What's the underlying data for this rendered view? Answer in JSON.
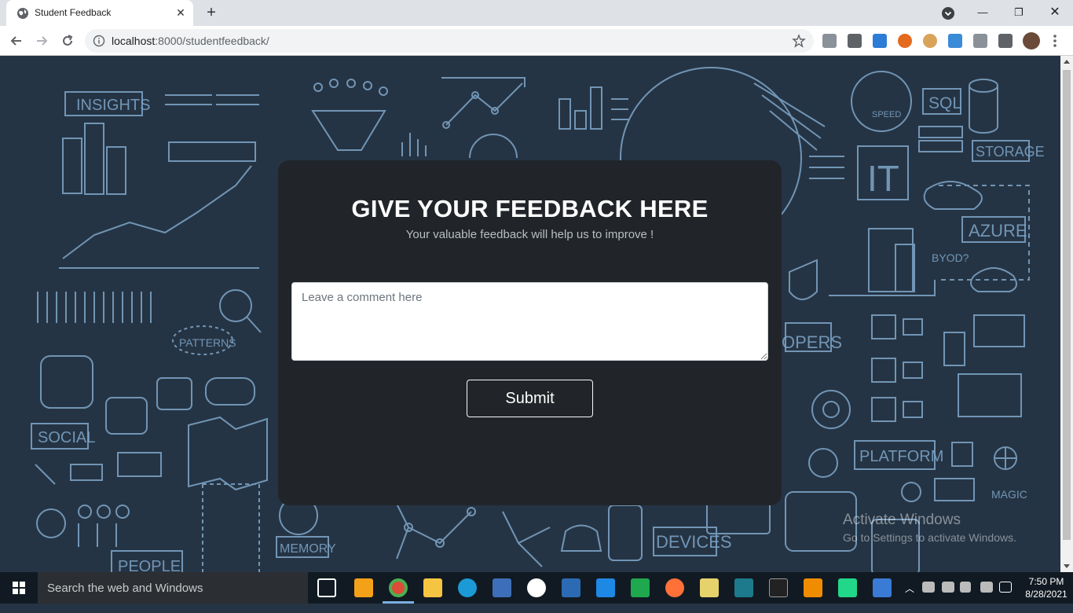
{
  "browser": {
    "tab_title": "Student Feedback",
    "url_host": "localhost",
    "url_rest": ":8000/studentfeedback/"
  },
  "feedback": {
    "title": "GIVE YOUR FEEDBACK HERE",
    "subtitle": "Your valuable feedback will help us to improve !",
    "comment_placeholder": "Leave a comment here",
    "submit_label": "Submit"
  },
  "background_labels": {
    "insights": "INSIGHTS",
    "patterns": "PATTERNS",
    "social": "SOCIAL",
    "people": "PEOPLE",
    "memory": "MEMORY",
    "devices": "DEVICES",
    "sql": "SQL",
    "storage": "STORAGE",
    "it": "IT",
    "azure": "AZURE",
    "byod": "BYOD?",
    "opers": "OPERS",
    "platform": "PLATFORM",
    "magic": "MAGIC",
    "speed": "SPEED"
  },
  "watermark": {
    "title": "Activate Windows",
    "subtitle": "Go to Settings to activate Windows."
  },
  "taskbar": {
    "search_placeholder": "Search the web and Windows",
    "time": "7:50 PM",
    "date": "8/28/2021"
  },
  "colors": {
    "page_bg": "#253444",
    "card_bg": "#212529",
    "sketch": "#7fa6c9"
  }
}
